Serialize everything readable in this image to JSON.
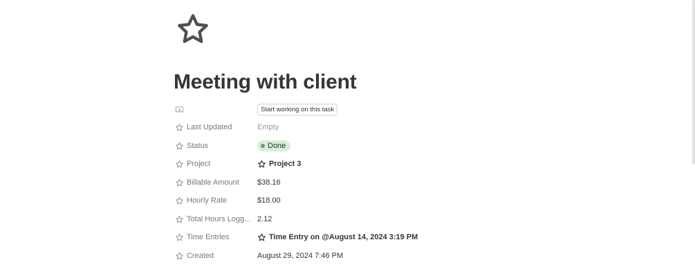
{
  "page": {
    "icon": "star-outline-icon",
    "title": "Meeting with client"
  },
  "properties": {
    "action": {
      "icon": "button-icon",
      "button_label": "Start working on this task"
    },
    "last_updated": {
      "label": "Last Updated",
      "value": "Empty",
      "icon": "star-outline-icon"
    },
    "status": {
      "label": "Status",
      "value": "Done",
      "icon": "star-outline-icon",
      "color": "#dbeddb",
      "dot_color": "#6c9b7d"
    },
    "project": {
      "label": "Project",
      "value": "Project 3",
      "icon": "star-outline-icon"
    },
    "billable_amount": {
      "label": "Billable Amount",
      "value": "$38.16",
      "icon": "star-outline-icon"
    },
    "hourly_rate": {
      "label": "Hourly Rate",
      "value": "$18.00",
      "icon": "star-outline-icon"
    },
    "total_hours": {
      "label": "Total Hours Logg...",
      "value": "2.12",
      "icon": "star-outline-icon"
    },
    "time_entries": {
      "label": "Time Entries",
      "value": "Time Entry on @August 14, 2024 3:19 PM",
      "icon": "star-outline-icon"
    },
    "created": {
      "label": "Created",
      "value": "August 29, 2024 7:46 PM",
      "icon": "star-outline-icon"
    }
  }
}
